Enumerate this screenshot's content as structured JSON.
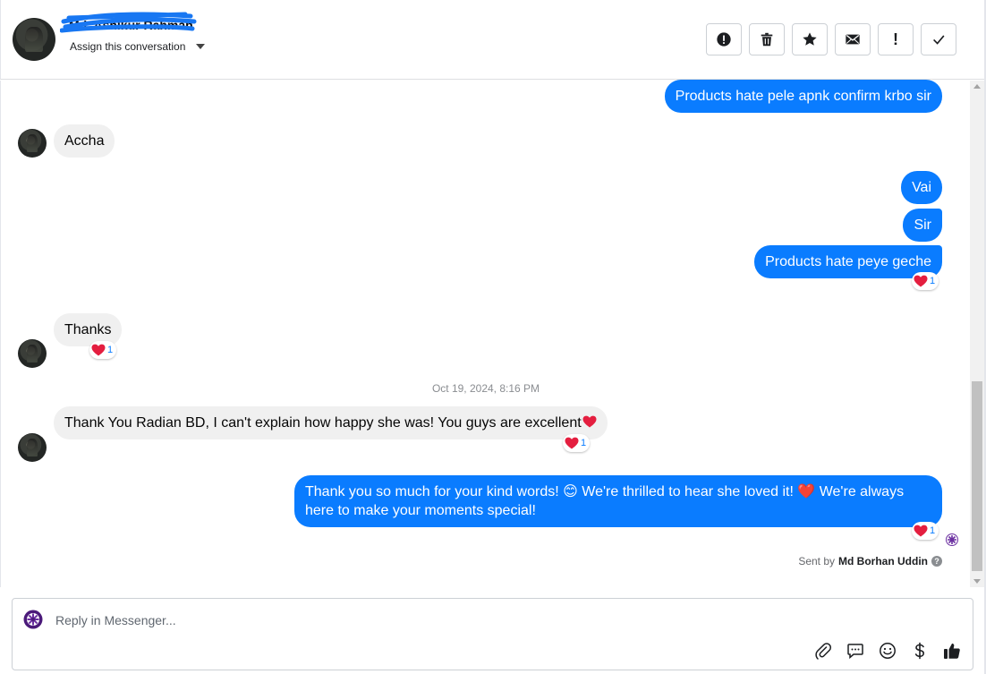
{
  "header": {
    "contact_name": "Md. Ashikur Rahman",
    "assign_label": "Assign this conversation",
    "actions": [
      {
        "name": "report-spam-button",
        "icon": "alert-circle-icon"
      },
      {
        "name": "delete-button",
        "icon": "trash-icon"
      },
      {
        "name": "star-button",
        "icon": "star-icon"
      },
      {
        "name": "mark-unread-button",
        "icon": "envelope-icon"
      },
      {
        "name": "follow-up-button",
        "icon": "exclamation-icon",
        "glyph": "!"
      },
      {
        "name": "mark-done-button",
        "icon": "check-icon"
      }
    ]
  },
  "messages": {
    "m1": "Products hate pele apnk confirm krbo sir",
    "m2": "Accha",
    "m3": "Vai",
    "m4": "Sir",
    "m5": "Products hate peye geche",
    "m5_reaction_count": "1",
    "m6": "Thanks",
    "m6_reaction_count": "1",
    "timestamp": "Oct 19, 2024, 8:16 PM",
    "m7": "Thank You Radian BD, I can't explain how happy she was! You guys are excellent",
    "m7_reaction_count": "1",
    "m8_line1": "Thank you so much for your kind words! 😊 We're thrilled to hear she loved it! ❤️ We're always",
    "m8_line2": "here to make your moments special!",
    "m8_reaction_count": "1"
  },
  "sent_by": {
    "prefix": "Sent by",
    "name": "Md Borhan Uddin"
  },
  "composer": {
    "placeholder": "Reply in Messenger..."
  },
  "colors": {
    "outgoing_bubble": "#0a7cff",
    "incoming_bubble": "#f0f0f0",
    "heart": "#e41e3f"
  }
}
